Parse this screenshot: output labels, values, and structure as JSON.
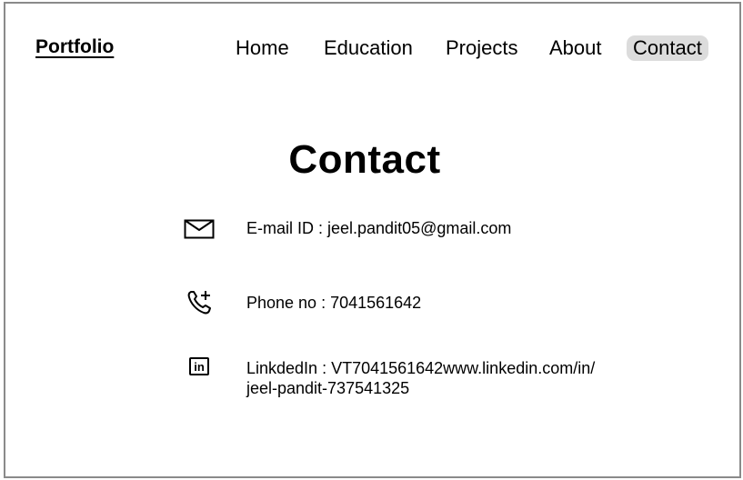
{
  "brand": "Portfolio",
  "nav": {
    "items": [
      "Home",
      "Education",
      "Projects",
      "About",
      "Contact"
    ],
    "active": "Contact"
  },
  "page_title": "Contact",
  "contact": {
    "email": "E-mail ID : jeel.pandit05@gmail.com",
    "phone": "Phone no : 7041561642",
    "linkedin_line1": "LinkdedIn : VT7041561642www.linkedin.com/in/",
    "linkedin_line2": "jeel-pandit-737541325",
    "linkedin_icon_text": "in",
    "icons": [
      "mail-icon",
      "phone-add-icon",
      "linkedin-icon"
    ]
  },
  "colors": {
    "active_nav_bg": "#dcdcdc",
    "border": "#8a8a8a"
  }
}
